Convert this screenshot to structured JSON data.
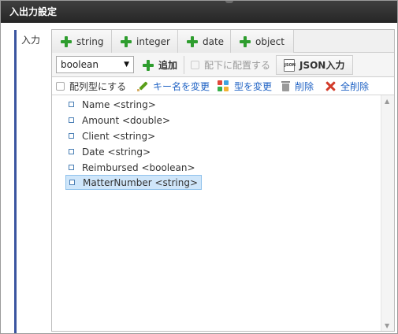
{
  "window": {
    "title": "入出力設定"
  },
  "section": {
    "label": "入力"
  },
  "type_buttons": [
    {
      "label": "string"
    },
    {
      "label": "integer"
    },
    {
      "label": "date"
    },
    {
      "label": "object"
    }
  ],
  "toolbar": {
    "type_select_value": "boolean",
    "add_label": "追加",
    "place_under_label": "配下に配置する",
    "json_input_label": "JSON入力",
    "json_icon_text": "JSON"
  },
  "actions": {
    "array_type_label": "配列型にする",
    "rename_key_label": "キー名を変更",
    "change_type_label": "型を変更",
    "delete_label": "削除",
    "delete_all_label": "全削除"
  },
  "tree": {
    "nodes": [
      {
        "name": "Name",
        "type": "<string>"
      },
      {
        "name": "Amount",
        "type": "<double>"
      },
      {
        "name": "Client",
        "type": "<string>"
      },
      {
        "name": "Date",
        "type": "<string>"
      },
      {
        "name": "Reimbursed",
        "type": "<boolean>"
      },
      {
        "name": "MatterNumber",
        "type": "<string>"
      }
    ],
    "selected_index": 5
  },
  "colors": {
    "titlebar": "#2e2e2e",
    "accent_bar": "#3a55a0",
    "plus_green": "#2e9d2e",
    "link_blue": "#1f62c4",
    "delete_red": "#d23b2a",
    "selection": "#cfe6fa"
  }
}
